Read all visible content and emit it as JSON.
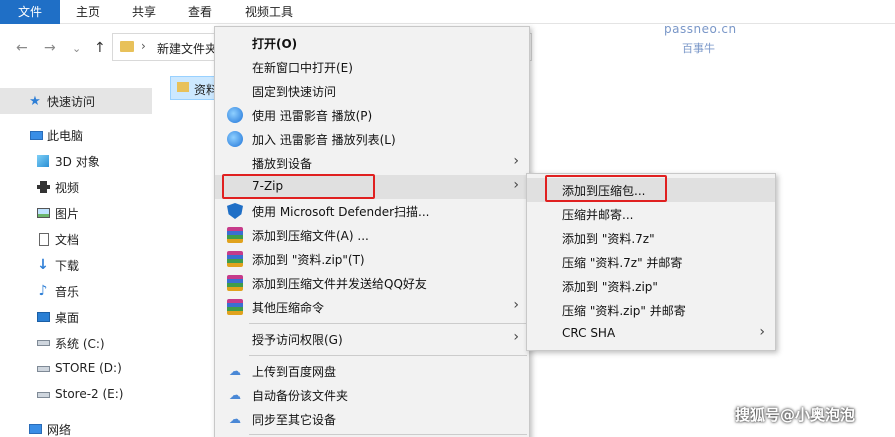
{
  "ribbon": {
    "tabs": [
      "文件",
      "主页",
      "共享",
      "查看",
      "视频工具"
    ]
  },
  "nav": {
    "back": "←",
    "forward": "→",
    "dropdown": "⌄",
    "up": "↑"
  },
  "address": {
    "separator": "›",
    "path": "新建文件夹"
  },
  "watermark": {
    "line1": "passneo.cn",
    "line2": "百事牛"
  },
  "sidebar": {
    "items": [
      {
        "label": "快速访问",
        "icon": "star-icon"
      },
      {
        "label": "此电脑",
        "icon": "computer-icon"
      },
      {
        "label": "3D 对象",
        "icon": "cube-icon"
      },
      {
        "label": "视频",
        "icon": "video-icon"
      },
      {
        "label": "图片",
        "icon": "picture-icon"
      },
      {
        "label": "文档",
        "icon": "document-icon"
      },
      {
        "label": "下载",
        "icon": "download-icon"
      },
      {
        "label": "音乐",
        "icon": "music-icon"
      },
      {
        "label": "桌面",
        "icon": "desktop-icon"
      },
      {
        "label": "系统 (C:)",
        "icon": "drive-icon"
      },
      {
        "label": "STORE (D:)",
        "icon": "drive-icon"
      },
      {
        "label": "Store-2 (E:)",
        "icon": "drive-icon"
      },
      {
        "label": "网络",
        "icon": "network-icon"
      }
    ]
  },
  "content": {
    "selected_item": "资料"
  },
  "context_menu": {
    "items": [
      "打开(O)",
      "在新窗口中打开(E)",
      "固定到快速访问",
      "使用 迅雷影音 播放(P)",
      "加入 迅雷影音 播放列表(L)",
      "播放到设备",
      "7-Zip",
      "使用 Microsoft Defender扫描...",
      "添加到压缩文件(A) ...",
      "添加到 \"资料.zip\"(T)",
      "添加到压缩文件并发送给QQ好友",
      "其他压缩命令",
      "授予访问权限(G)",
      "上传到百度网盘",
      "自动备份该文件夹",
      "同步至其它设备"
    ],
    "arrow": "›"
  },
  "submenu": {
    "items": [
      "添加到压缩包...",
      "压缩并邮寄...",
      "添加到 \"资料.7z\"",
      "压缩 \"资料.7z\" 并邮寄",
      "添加到 \"资料.zip\"",
      "压缩 \"资料.zip\" 并邮寄",
      "CRC SHA"
    ]
  },
  "footer_watermark": "搜狐号@小奥泡泡",
  "colors": {
    "file_tab": "#1f6fc6",
    "highlight": "#e02020",
    "menu_bg": "#f2f2f2"
  }
}
